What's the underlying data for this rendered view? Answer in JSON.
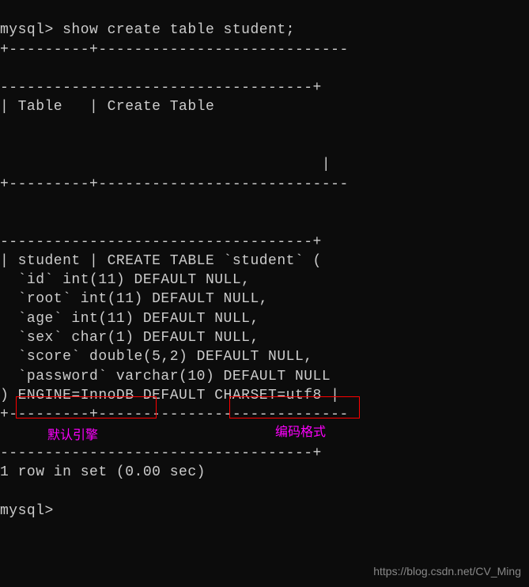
{
  "prompt1": "mysql> ",
  "command": "show create table student;",
  "sep_top1": "+---------+----------------------------",
  "sep_top2": "-----------------------------------+",
  "header_row": "| Table   | Create Table",
  "header_pipe": "                                    |",
  "sep_mid1": "+---------+----------------------------",
  "sep_mid2": "-----------------------------------+",
  "create_line": "| student | CREATE TABLE `student` (",
  "col_id": "  `id` int(11) DEFAULT NULL,",
  "col_root": "  `root` int(11) DEFAULT NULL,",
  "col_age": "  `age` int(11) DEFAULT NULL,",
  "col_sex": "  `sex` char(1) DEFAULT NULL,",
  "col_score": "  `score` double(5,2) DEFAULT NULL,",
  "col_password": "  `password` varchar(10) DEFAULT NULL",
  "engine_line": ") ENGINE=InnoDB DEFAULT CHARSET=utf8 |",
  "sep_bot1": "+---------+----------------------------",
  "sep_bot2": "-----------------------------------+",
  "result": "1 row in set (0.00 sec)",
  "prompt2": "mysql>",
  "annotation_engine": "默认引擎",
  "annotation_charset": "编码格式",
  "watermark": "https://blog.csdn.net/CV_Ming"
}
